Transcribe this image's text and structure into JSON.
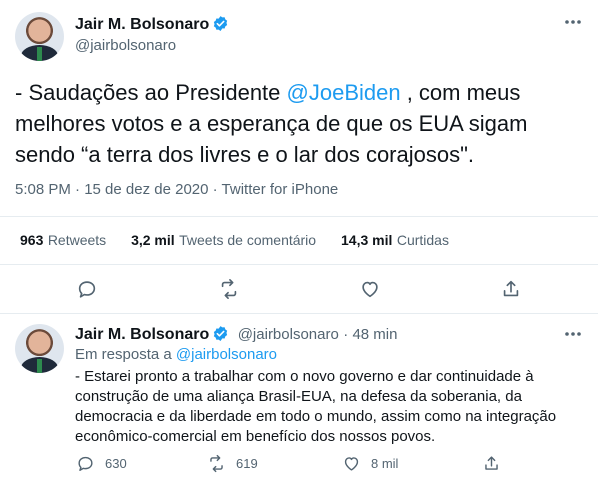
{
  "tweet": {
    "author": {
      "name": "Jair M. Bolsonaro",
      "handle": "@jairbolsonaro",
      "verified": true
    },
    "text_lines": [
      {
        "pre": "- Saudações ao Presidente ",
        "mention": "@JoeBiden",
        "post": " , com meus"
      },
      "melhores votos e a esperança de que os EUA sigam",
      "sendo “a terra dos livres e o lar dos corajosos\"."
    ],
    "meta": "5:08 PM · 15 de dez de 2020 · Twitter for iPhone",
    "stats": {
      "retweets": {
        "count": "963",
        "label": "Retweets"
      },
      "quotes": {
        "count": "3,2 mil",
        "label": "Tweets de comentário"
      },
      "likes": {
        "count": "14,3 mil",
        "label": "Curtidas"
      }
    },
    "actions": [
      "reply-icon",
      "retweet-icon",
      "like-icon",
      "share-icon"
    ]
  },
  "reply": {
    "author": {
      "name": "Jair M. Bolsonaro",
      "handle": "@jairbolsonaro",
      "time": "· 48 min"
    },
    "in_reply_prefix": "Em resposta a ",
    "in_reply_handle": "@jairbolsonaro",
    "text_lines": [
      "- Estarei pronto a trabalhar com o novo governo e dar continuidade à",
      "construção de uma aliança Brasil-EUA, na defesa da soberania, da",
      "democracia e da liberdade em todo o mundo, assim como na integração",
      "econômico-comercial em benefício dos nossos povos."
    ],
    "counts": {
      "replies": "630",
      "retweets": "619",
      "likes": "8 mil"
    }
  },
  "colors": {
    "accent": "#1d9bf0",
    "muted": "#536471",
    "divider": "#e6ecf0"
  }
}
